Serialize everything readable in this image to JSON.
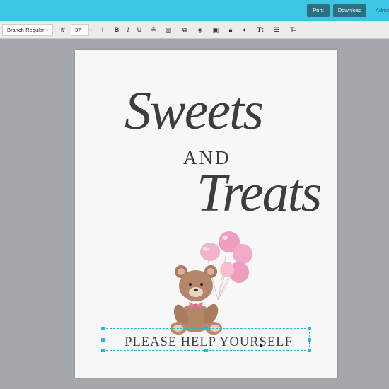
{
  "topbar": {
    "print_label": "Print",
    "download_label": "Download",
    "admin_label": "Admin"
  },
  "toolbar": {
    "font_name": "Branch-Regular",
    "font_size": "37",
    "icons": [
      "font-style-icon",
      "line-height-icon",
      "bold-icon",
      "italic-icon",
      "underline-icon",
      "align-icon",
      "image-icon",
      "duplicate-icon",
      "layers-icon",
      "delete-icon",
      "lock-icon",
      "color-icon",
      "text-size-icon",
      "list-icon",
      "clear-format-icon"
    ]
  },
  "document": {
    "title_line1": "Sweets",
    "title_and": "AND",
    "title_line2": "Treats",
    "subtitle": "PLEASE HELP YOURSELF"
  },
  "colors": {
    "topbar": "#3cc6e4",
    "button": "#2a6f82",
    "selection": "#2bb7d8",
    "balloon": "#f2a9c6",
    "bear": "#b5876a"
  }
}
